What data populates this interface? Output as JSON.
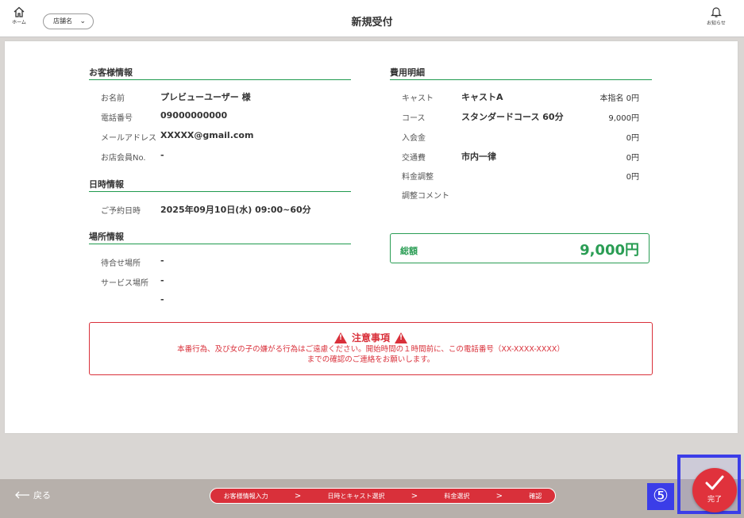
{
  "header": {
    "home_label": "ホーム",
    "store_select": "店舗名",
    "title": "新規受付",
    "notice_label": "お知らせ"
  },
  "customer": {
    "section": "お客様情報",
    "rows": [
      {
        "label": "お名前",
        "value": "プレビューユーザー 様"
      },
      {
        "label": "電話番号",
        "value": "09000000000"
      },
      {
        "label": "メールアドレス",
        "value": "XXXXX@gmail.com"
      },
      {
        "label": "お店会員No.",
        "value": "-"
      }
    ]
  },
  "datetime": {
    "section": "日時情報",
    "rows": [
      {
        "label": "ご予約日時",
        "value": "2025年09月10日(水) 09:00~60分"
      }
    ]
  },
  "place": {
    "section": "場所情報",
    "rows": [
      {
        "label": "待合せ場所",
        "value": "-"
      },
      {
        "label": "サービス場所",
        "value": "-"
      },
      {
        "label": "",
        "value": "-"
      }
    ]
  },
  "cost": {
    "section": "費用明細",
    "rows": [
      {
        "label": "キャスト",
        "value": "キャストA",
        "amount": "本指名 0円"
      },
      {
        "label": "コース",
        "value": "スタンダードコース 60分",
        "amount": "9,000円"
      },
      {
        "label": "入会金",
        "value": "",
        "amount": "0円"
      },
      {
        "label": "交通費",
        "value": "市内一律",
        "amount": "0円"
      },
      {
        "label": "料金調整",
        "value": "",
        "amount": "0円"
      },
      {
        "label": "調整コメント",
        "value": "",
        "amount": ""
      }
    ],
    "total_label": "総額",
    "total_value": "9,000円"
  },
  "notice": {
    "title": "注意事項",
    "line1": "本番行為、及び女の子の嫌がる行為はご遠慮ください。開始時間の１時間前に、この電話番号（XX-XXXX-XXXX）",
    "line2": "までの確認のご連絡をお願いします。"
  },
  "footer": {
    "back_label": "戻る",
    "steps": [
      "お客様情報入力",
      "日時とキャスト選択",
      "料金選択",
      "確認"
    ],
    "step_sep": ">",
    "done_label": "完了",
    "badge": "⑤"
  },
  "colors": {
    "accent_green": "#2a9d54",
    "accent_red": "#d9303a",
    "highlight_blue": "#3b3de8"
  }
}
